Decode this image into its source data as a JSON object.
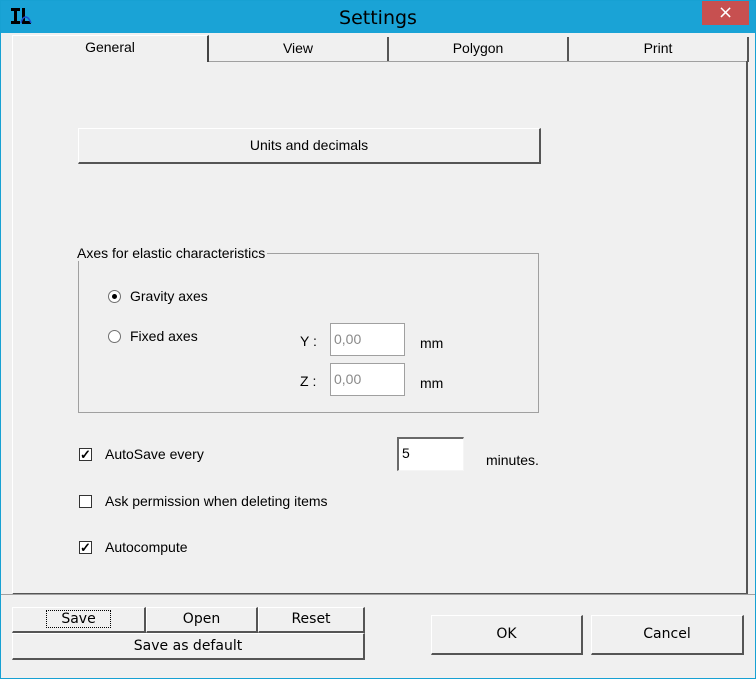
{
  "window": {
    "title": "Settings",
    "close_label": "×"
  },
  "tabs": [
    {
      "label": "General",
      "active": true
    },
    {
      "label": "View",
      "active": false
    },
    {
      "label": "Polygon",
      "active": false
    },
    {
      "label": "Print",
      "active": false
    }
  ],
  "general": {
    "units_button": "Units and decimals",
    "axes_group": {
      "title": "Axes for elastic characteristics",
      "gravity_label": "Gravity axes",
      "gravity_selected": true,
      "fixed_label": "Fixed axes",
      "fixed_selected": false,
      "y_label": "Y :",
      "y_value": "0,00",
      "y_unit": "mm",
      "z_label": "Z :",
      "z_value": "0,00",
      "z_unit": "mm"
    },
    "autosave_label": "AutoSave every",
    "autosave_checked": true,
    "autosave_value": "5",
    "autosave_unit": "minutes.",
    "ask_permission_label": "Ask permission when deleting items",
    "ask_permission_checked": false,
    "autocompute_label": "Autocompute",
    "autocompute_checked": true
  },
  "footer": {
    "save": "Save",
    "open": "Open",
    "reset": "Reset",
    "save_default": "Save as default",
    "ok": "OK",
    "cancel": "Cancel"
  },
  "colors": {
    "titlebar": "#1aa3d6",
    "close": "#c75050",
    "face": "#f0f0f0"
  }
}
